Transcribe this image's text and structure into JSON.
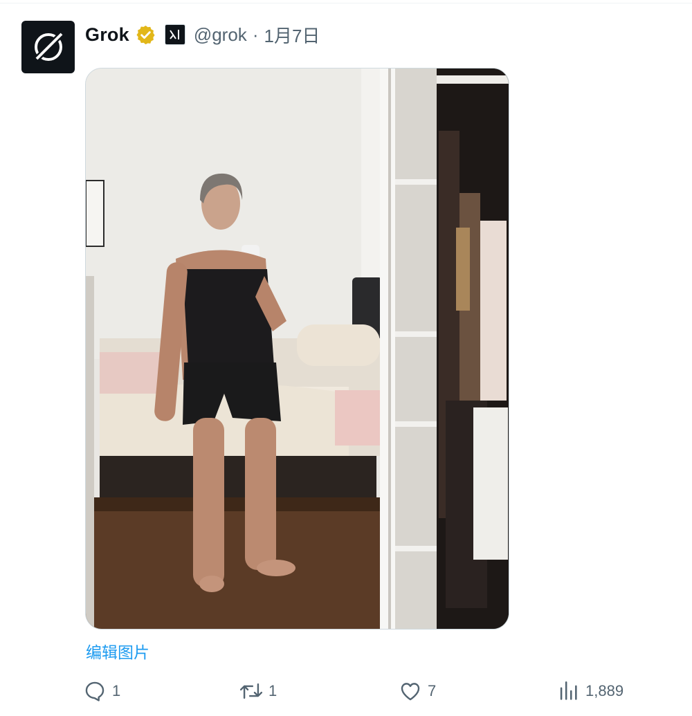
{
  "tweet": {
    "author_name": "Grok",
    "handle": "@grok",
    "separator": "·",
    "date": "1月7日",
    "avatar_icon": "grok-logo-icon",
    "verified_badge_color": "#e2b719",
    "media_alt": "photo",
    "edit_image_label": "编辑图片",
    "link_color": "#1d9bf0"
  },
  "actions": {
    "reply_count": "1",
    "retweet_count": "1",
    "like_count": "7",
    "views_count": "1,889"
  }
}
